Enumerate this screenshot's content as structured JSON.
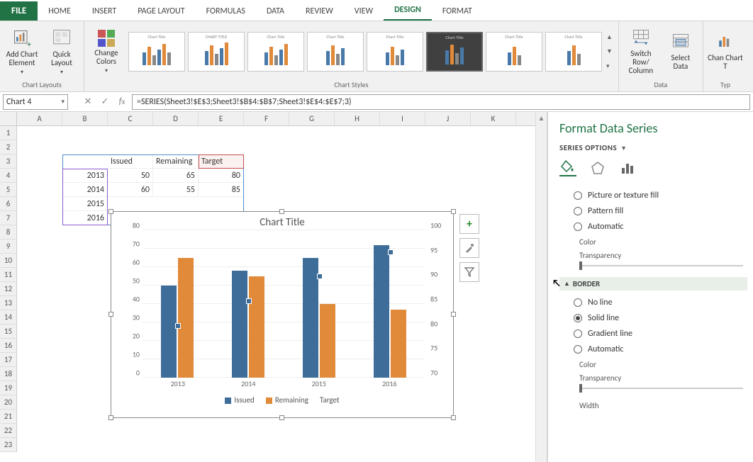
{
  "tabs": {
    "file": "FILE",
    "home": "HOME",
    "insert": "INSERT",
    "page_layout": "PAGE LAYOUT",
    "formulas": "FORMULAS",
    "data": "DATA",
    "review": "REVIEW",
    "view": "VIEW",
    "design": "DESIGN",
    "format": "FORMAT"
  },
  "ribbon": {
    "groups": {
      "chart_layouts": "Chart Layouts",
      "chart_styles": "Chart Styles",
      "data": "Data",
      "type": "Typ"
    },
    "buttons": {
      "add_chart_element": "Add Chart Element",
      "quick_layout": "Quick Layout",
      "change_colors": "Change Colors",
      "switch_row_col": "Switch Row/ Column",
      "select_data": "Select Data",
      "change_chart_type": "Chan Chart T"
    }
  },
  "name_box": "Chart 4",
  "formula": "=SERIES(Sheet3!$E$3;Sheet3!$B$4:$B$7;Sheet3!$E$4:$E$7;3)",
  "columns": [
    "A",
    "B",
    "C",
    "D",
    "E",
    "F",
    "G",
    "H",
    "I",
    "J",
    "K"
  ],
  "sheet": {
    "headers": {
      "issued": "Issued",
      "remaining": "Remaining",
      "target": "Target"
    },
    "rows": [
      {
        "year": "2013",
        "issued": "50",
        "remaining": "65",
        "target": "80"
      },
      {
        "year": "2014",
        "issued": "60",
        "remaining": "55",
        "target": "85"
      },
      {
        "year": "2015",
        "issued": "",
        "remaining": "",
        "target": ""
      },
      {
        "year": "2016",
        "issued": "",
        "remaining": "",
        "target": ""
      }
    ]
  },
  "chart_data": {
    "type": "bar",
    "title": "Chart Title",
    "categories": [
      "2013",
      "2014",
      "2015",
      "2016"
    ],
    "series": [
      {
        "name": "Issued",
        "values": [
          50,
          58,
          65,
          72
        ],
        "axis": "primary",
        "kind": "bar",
        "color": "#3f6d99"
      },
      {
        "name": "Remaining",
        "values": [
          65,
          55,
          40,
          37
        ],
        "axis": "primary",
        "kind": "bar",
        "color": "#e08a3a"
      },
      {
        "name": "Target",
        "values": [
          80,
          85,
          90,
          95
        ],
        "axis": "secondary",
        "kind": "scatter",
        "color": "#3f6d99"
      }
    ],
    "ylim": [
      0,
      80
    ],
    "y_ticks": [
      0,
      10,
      20,
      30,
      40,
      50,
      60,
      70,
      80
    ],
    "y2lim": [
      70,
      100
    ],
    "y2_ticks": [
      70,
      75,
      80,
      85,
      90,
      95,
      100
    ],
    "legend": [
      "Issued",
      "Remaining",
      "Target"
    ]
  },
  "pane": {
    "title": "Format Data Series",
    "subtitle": "SERIES OPTIONS",
    "fill_options": {
      "picture": "Picture or texture fill",
      "pattern": "Pattern fill",
      "automatic": "Automatic"
    },
    "border_header": "BORDER",
    "border_options": {
      "no_line": "No line",
      "solid": "Solid line",
      "gradient": "Gradient line",
      "automatic": "Automatic"
    },
    "labels": {
      "color": "Color",
      "transparency": "Transparency",
      "width": "Width"
    }
  }
}
